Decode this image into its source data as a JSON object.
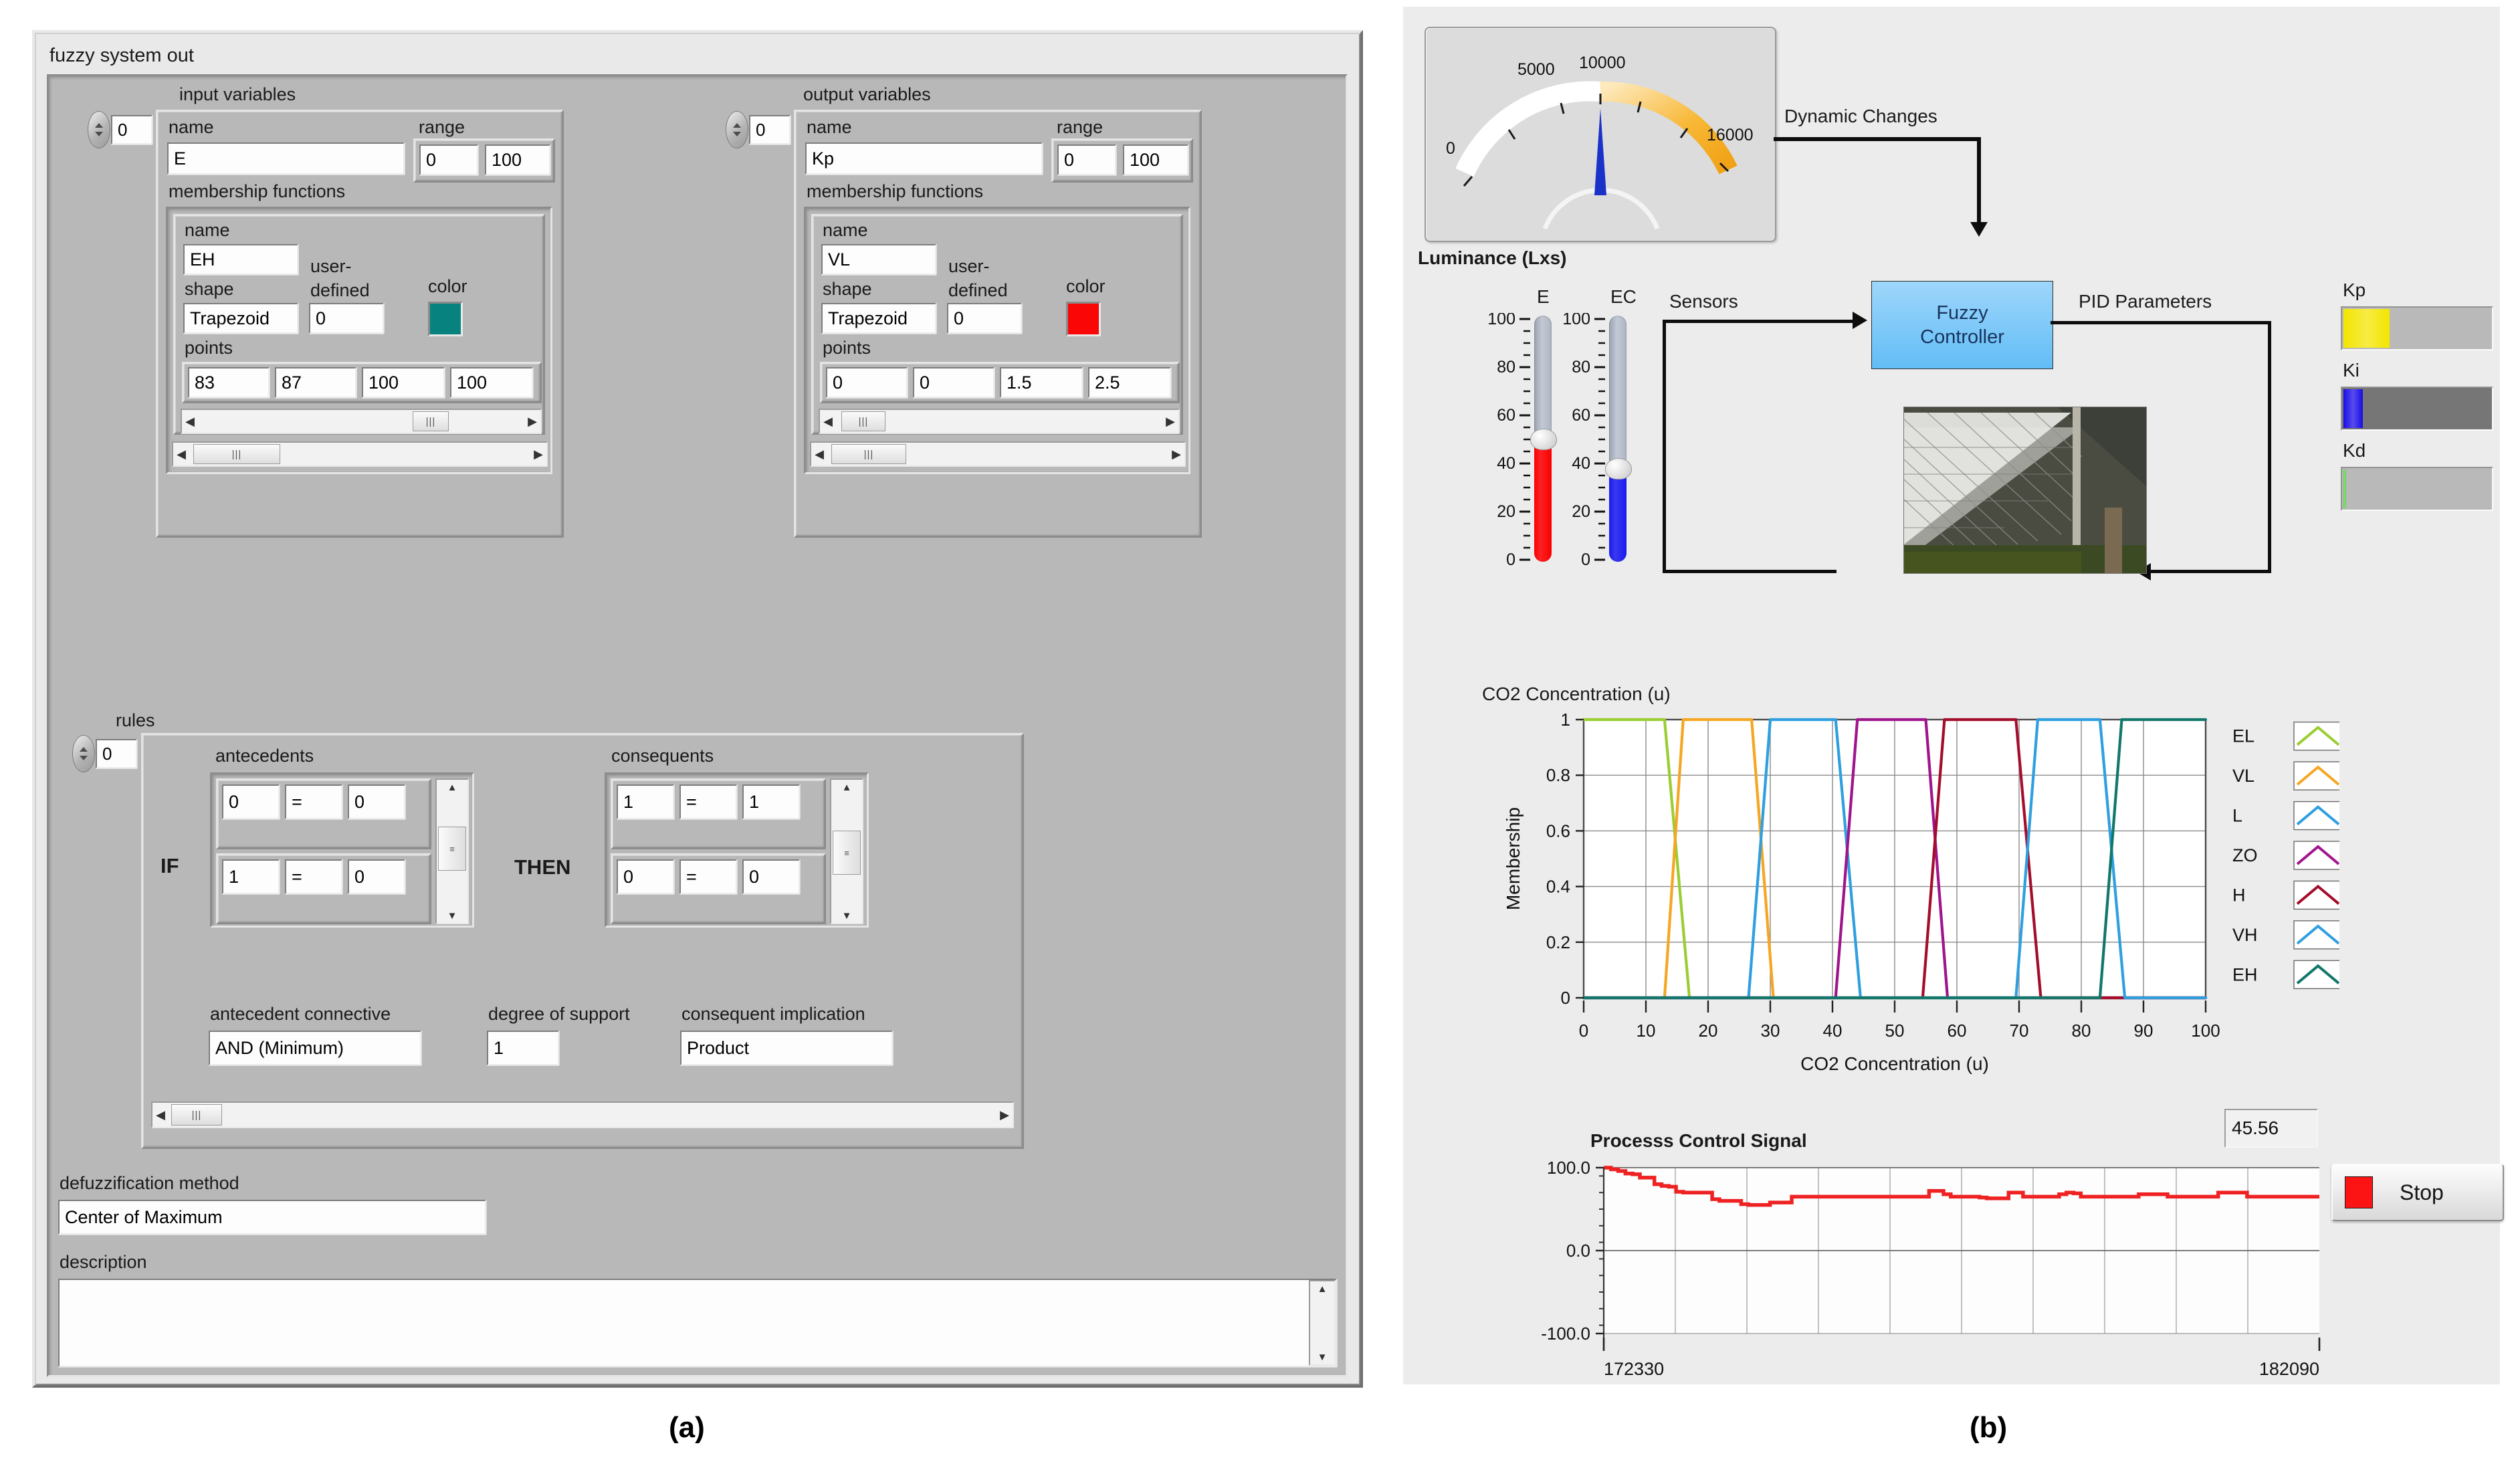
{
  "figure": {
    "caption_a": "(a)",
    "caption_b": "(b)"
  },
  "panel_a": {
    "title": "fuzzy system out",
    "input_variables": {
      "group_label": "input variables",
      "index": "0",
      "name_label": "name",
      "name_value": "E",
      "range_label": "range",
      "range_min": "0",
      "range_max": "100",
      "mf_group_label": "membership functions",
      "mf_name_label": "name",
      "mf_name_value": "EH",
      "mf_shape_label": "shape",
      "mf_shape_value": "Trapezoid",
      "mf_userdef_label_1": "user-",
      "mf_userdef_label_2": "defined",
      "mf_userdef_value": "0",
      "mf_color_label": "color",
      "mf_color_value": "#08827f",
      "mf_points_label": "points",
      "mf_points": [
        "83",
        "87",
        "100",
        "100"
      ]
    },
    "output_variables": {
      "group_label": "output variables",
      "index": "0",
      "name_label": "name",
      "name_value": "Kp",
      "range_label": "range",
      "range_min": "0",
      "range_max": "100",
      "mf_group_label": "membership functions",
      "mf_name_label": "name",
      "mf_name_value": "VL",
      "mf_shape_label": "shape",
      "mf_shape_value": "Trapezoid",
      "mf_userdef_label_1": "user-",
      "mf_userdef_label_2": "defined",
      "mf_userdef_value": "0",
      "mf_color_label": "color",
      "mf_color_value": "#fb0606",
      "mf_points_label": "points",
      "mf_points": [
        "0",
        "0",
        "1.5",
        "2.5"
      ]
    },
    "rules": {
      "group_label": "rules",
      "index": "0",
      "if_label": "IF",
      "then_label": "THEN",
      "antecedents_label": "antecedents",
      "consequents_label": "consequents",
      "antecedents": [
        {
          "var": "0",
          "op": "=",
          "term": "0"
        },
        {
          "var": "1",
          "op": "=",
          "term": "0"
        }
      ],
      "consequents": [
        {
          "var": "1",
          "op": "=",
          "term": "1"
        },
        {
          "var": "0",
          "op": "=",
          "term": "0"
        }
      ],
      "antecedent_connective_label": "antecedent connective",
      "antecedent_connective_value": "AND (Minimum)",
      "degree_of_support_label": "degree of support",
      "degree_of_support_value": "1",
      "consequent_implication_label": "consequent implication",
      "consequent_implication_value": "Product"
    },
    "defuzzification_label": "defuzzification method",
    "defuzzification_value": "Center of Maximum",
    "description_label": "description",
    "description_value": ""
  },
  "panel_b": {
    "gauge": {
      "label": "Luminance (Lxs)",
      "ticks": [
        "0",
        "5000",
        "10000",
        "16000"
      ],
      "min": 0,
      "max": 16000,
      "value": 8600,
      "scale_color_low": "#ffffff",
      "scale_color_high": "#f5ab17",
      "needle_color": "#1b32c8"
    },
    "dynamic_changes_label": "Dynamic Changes",
    "sensors_label": "Sensors",
    "pid_parameters_label": "PID Parameters",
    "fuzzy_controller_line1": "Fuzzy",
    "fuzzy_controller_line2": "Controller",
    "sliders": [
      {
        "name": "E",
        "value": 50,
        "min": 0,
        "max": 100,
        "fill_color": "#fb0000",
        "ticks": [
          "100",
          "80",
          "60",
          "40",
          "20",
          "0"
        ]
      },
      {
        "name": "EC",
        "value": 38,
        "min": 0,
        "max": 100,
        "fill_color": "#1a1aee",
        "ticks": [
          "100",
          "80",
          "60",
          "40",
          "20",
          "0"
        ]
      }
    ],
    "pid_bars": [
      {
        "name": "Kp",
        "fill_color": "#f3e500",
        "fill_pct": 31,
        "track_color": "#b9b9b9"
      },
      {
        "name": "Ki",
        "fill_color": "#1a0ce6",
        "fill_pct": 13,
        "track_color": "#767676"
      },
      {
        "name": "Kd",
        "fill_color": "#5fd24b",
        "fill_pct": 2,
        "track_color": "#b9b9b9"
      }
    ],
    "readout_value": "45.56",
    "stop_label": "Stop",
    "stop_led_color": "#fc1414"
  },
  "chart_data": [
    {
      "type": "line",
      "id": "membership_chart",
      "title": "CO2 Concentration (u)",
      "xlabel": "CO2 Concentration (u)",
      "ylabel": "Membership",
      "xlim": [
        0,
        100
      ],
      "ylim": [
        0,
        1
      ],
      "xticks": [
        0,
        10,
        20,
        30,
        40,
        50,
        60,
        70,
        80,
        90,
        100
      ],
      "yticks": [
        0,
        0.2,
        0.4,
        0.6,
        0.8,
        1
      ],
      "grid": true,
      "legend_position": "right",
      "series": [
        {
          "name": "EL",
          "color": "#9acd32",
          "points": [
            [
              0,
              1
            ],
            [
              13,
              1
            ],
            [
              17,
              0
            ],
            [
              100,
              0
            ]
          ]
        },
        {
          "name": "VL",
          "color": "#f5a623",
          "points": [
            [
              0,
              0
            ],
            [
              13,
              0
            ],
            [
              16,
              1
            ],
            [
              27,
              1
            ],
            [
              30.5,
              0
            ],
            [
              100,
              0
            ]
          ]
        },
        {
          "name": "L",
          "color": "#2f9fe0",
          "points": [
            [
              0,
              0
            ],
            [
              26.5,
              0
            ],
            [
              30,
              1
            ],
            [
              40.5,
              1
            ],
            [
              44.5,
              0
            ],
            [
              100,
              0
            ]
          ]
        },
        {
          "name": "ZO",
          "color": "#a0148c",
          "points": [
            [
              0,
              0
            ],
            [
              40.5,
              0
            ],
            [
              44,
              1
            ],
            [
              55,
              1
            ],
            [
              58.5,
              0
            ],
            [
              100,
              0
            ]
          ]
        },
        {
          "name": "H",
          "color": "#a50d2c",
          "points": [
            [
              0,
              0
            ],
            [
              54.5,
              0
            ],
            [
              58,
              1
            ],
            [
              69.5,
              1
            ],
            [
              73.5,
              0
            ],
            [
              100,
              0
            ]
          ]
        },
        {
          "name": "VH",
          "color": "#2f9fe0",
          "points": [
            [
              0,
              0
            ],
            [
              69.5,
              0
            ],
            [
              73,
              1
            ],
            [
              83,
              1
            ],
            [
              87,
              0
            ],
            [
              100,
              0
            ]
          ]
        },
        {
          "name": "EH",
          "color": "#12776b",
          "points": [
            [
              0,
              0
            ],
            [
              83,
              0
            ],
            [
              86.5,
              1
            ],
            [
              100,
              1
            ]
          ]
        }
      ]
    },
    {
      "type": "line",
      "id": "process_control_signal",
      "title": "Processs Control Signal",
      "xlabel": "",
      "ylabel": "",
      "ylim": [
        -100.0,
        100.0
      ],
      "yticks": [
        "100.0",
        "0.0",
        "-100.0"
      ],
      "xticks": [
        "172330",
        "182090"
      ],
      "x_start": 172330,
      "x_end": 182090,
      "grid": true,
      "line_color": "#ee2222",
      "values": [
        100,
        98,
        96,
        93,
        92,
        88,
        88,
        80,
        78,
        77,
        71,
        70,
        70,
        70,
        70,
        62,
        60,
        60,
        60,
        56,
        55,
        55,
        55,
        58,
        58,
        58,
        65,
        65,
        65,
        65,
        65,
        65,
        65,
        65,
        65,
        65,
        65,
        65,
        65,
        65,
        65,
        65,
        65,
        65,
        65,
        72,
        72,
        68,
        65,
        65,
        65,
        65,
        64,
        63,
        63,
        63,
        70,
        70,
        65,
        65,
        65,
        65,
        65,
        68,
        70,
        69,
        65,
        65,
        65,
        65,
        65,
        65,
        65,
        65,
        68,
        68,
        68,
        68,
        65,
        65,
        65,
        65,
        65,
        65,
        65,
        70,
        70,
        70,
        70,
        65,
        65,
        65,
        65,
        65,
        65,
        65,
        65,
        65,
        65,
        65
      ]
    }
  ]
}
